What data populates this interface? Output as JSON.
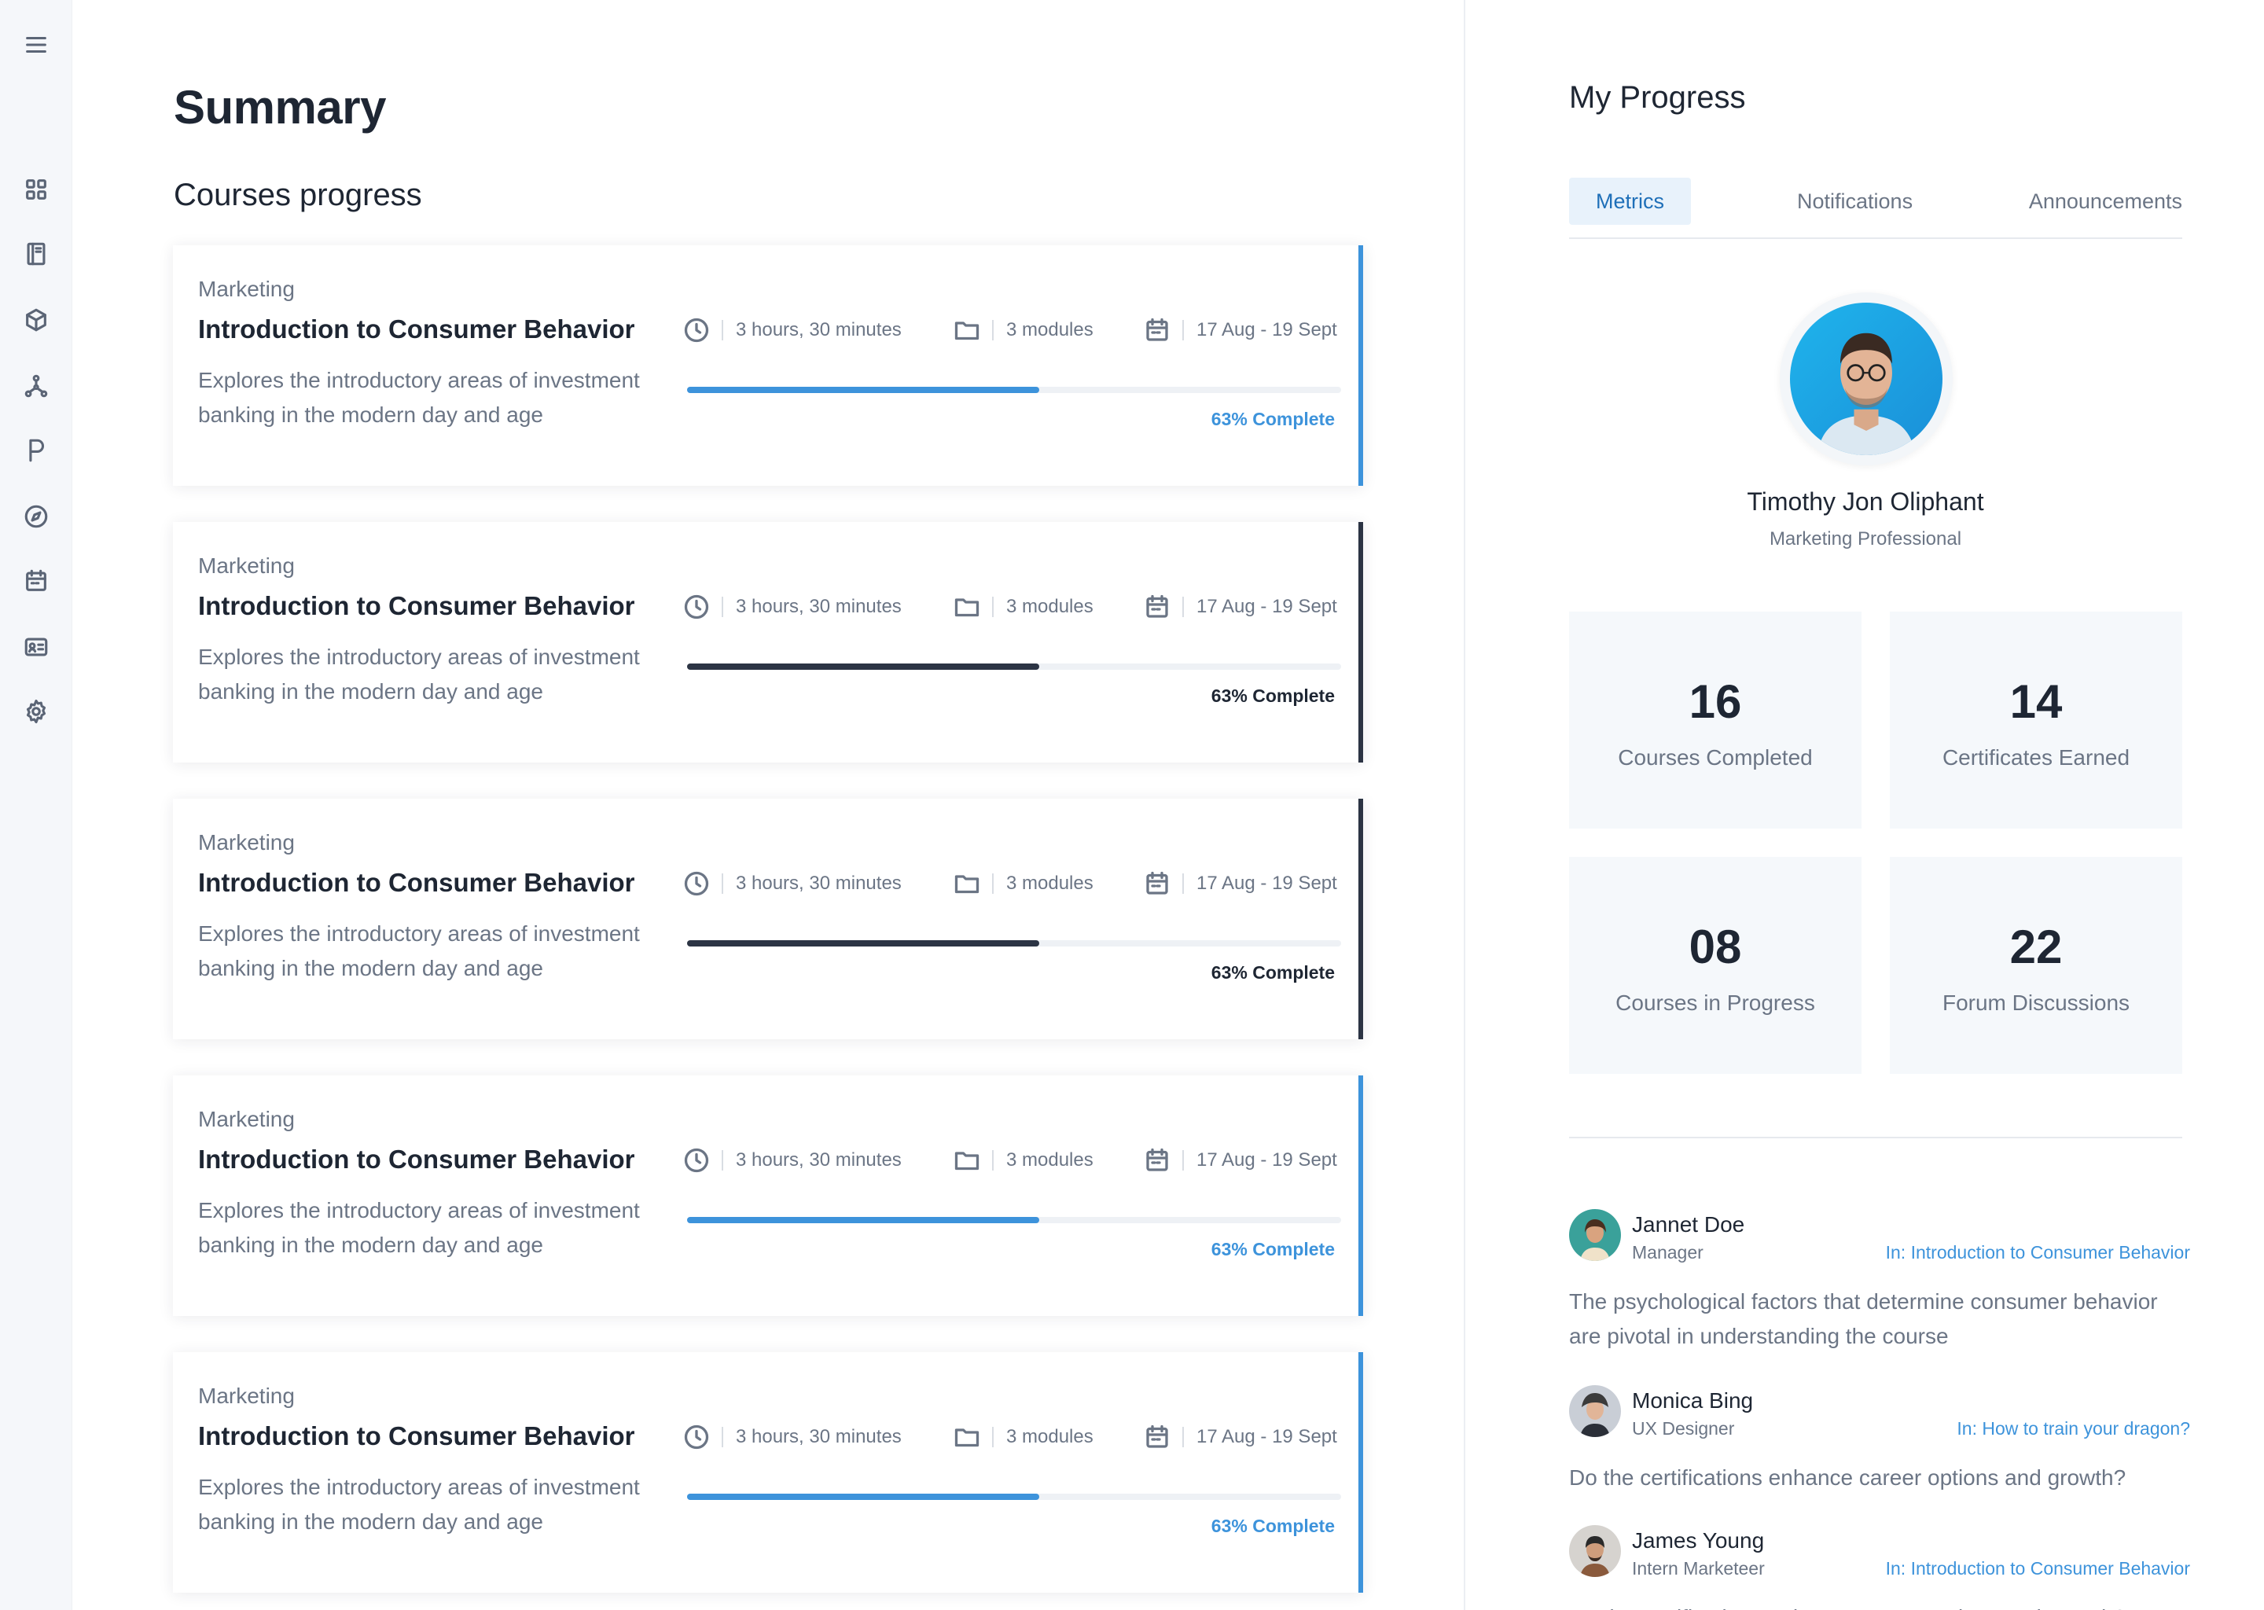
{
  "summary": {
    "title": "Summary",
    "section_title": "Courses progress"
  },
  "courses": [
    {
      "category": "Marketing",
      "title": "Introduction to Consumer Behavior",
      "description": "Explores the introductory areas of investment banking in the modern day and age",
      "duration": "3 hours, 30 minutes",
      "modules": "3 modules",
      "dates": "17 Aug - 19 Sept",
      "progress": 0.63,
      "progress_label": "63% Complete",
      "accent": "#3d93db"
    },
    {
      "category": "Marketing",
      "title": "Introduction to Consumer Behavior",
      "description": "Explores the introductory areas of investment banking in the modern day and age",
      "duration": "3 hours, 30 minutes",
      "modules": "3 modules",
      "dates": "17 Aug - 19 Sept",
      "progress": 0.63,
      "progress_label": "63% Complete",
      "accent": "#2c3444"
    },
    {
      "category": "Marketing",
      "title": "Introduction to Consumer Behavior",
      "description": "Explores the introductory areas of investment banking in the modern day and age",
      "duration": "3 hours, 30 minutes",
      "modules": "3 modules",
      "dates": "17 Aug - 19 Sept",
      "progress": 0.63,
      "progress_label": "63% Complete",
      "accent": "#2c3444"
    },
    {
      "category": "Marketing",
      "title": "Introduction to Consumer Behavior",
      "description": "Explores the introductory areas of investment banking in the modern day and age",
      "duration": "3 hours, 30 minutes",
      "modules": "3 modules",
      "dates": "17 Aug - 19 Sept",
      "progress": 0.63,
      "progress_label": "63% Complete",
      "accent": "#3d93db"
    },
    {
      "category": "Marketing",
      "title": "Introduction to Consumer Behavior",
      "description": "Explores the introductory areas of investment banking in the modern day and age",
      "duration": "3 hours, 30 minutes",
      "modules": "3 modules",
      "dates": "17 Aug - 19 Sept",
      "progress": 0.63,
      "progress_label": "63% Complete",
      "accent": "#3d93db"
    }
  ],
  "sidebar": {
    "icons": [
      "menu-icon",
      "dashboard-icon",
      "book-icon",
      "cube-icon",
      "network-icon",
      "p-letter-icon",
      "compass-icon",
      "calendar-icon",
      "id-card-icon",
      "settings-icon"
    ]
  },
  "progress_panel": {
    "title": "My Progress",
    "tabs": [
      {
        "label": "Metrics",
        "active": true
      },
      {
        "label": "Notifications",
        "active": false
      },
      {
        "label": "Announcements",
        "active": false
      }
    ],
    "profile": {
      "name": "Timothy Jon Oliphant",
      "role": "Marketing Professional"
    },
    "stats": [
      {
        "value": "16",
        "label": "Courses Completed"
      },
      {
        "value": "14",
        "label": "Certificates Earned"
      },
      {
        "value": "08",
        "label": "Courses in Progress"
      },
      {
        "value": "22",
        "label": "Forum Discussions"
      }
    ],
    "discussions": [
      {
        "name": "Jannet Doe",
        "role": "Manager",
        "course": "In: Introduction to Consumer Behavior",
        "text": "The psychological factors that determine consumer behavior are pivotal in understanding the course"
      },
      {
        "name": "Monica Bing",
        "role": "UX Designer",
        "course": "In: How to train your dragon?",
        "text": "Do the certifications enhance career options and growth?"
      },
      {
        "name": "James Young",
        "role": "Intern Marketeer",
        "course": "In: Introduction to Consumer Behavior",
        "text": "Do the certifications enhance career options and growth?"
      }
    ]
  },
  "colors": {
    "accent_blue": "#3d93db",
    "accent_dark": "#2c3444",
    "text_primary": "#1e2633",
    "text_secondary": "#6b7585"
  }
}
